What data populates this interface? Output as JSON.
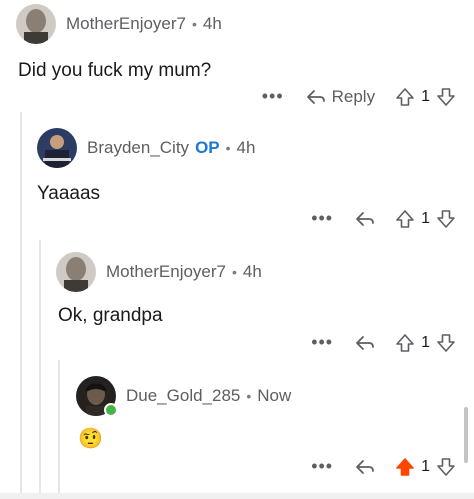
{
  "comments": [
    {
      "username": "MotherEnjoyer7",
      "op": "",
      "time": "4h",
      "body": "Did you fuck my mum?",
      "reply_label": "Reply",
      "votes": "1",
      "upvoted": false
    },
    {
      "username": "Brayden_City",
      "op": "OP",
      "time": "4h",
      "body": "Yaaaas",
      "reply_label": "",
      "votes": "1",
      "upvoted": false
    },
    {
      "username": "MotherEnjoyer7",
      "op": "",
      "time": "4h",
      "body": "Ok, grandpa",
      "reply_label": "",
      "votes": "1",
      "upvoted": false
    },
    {
      "username": "Due_Gold_285",
      "op": "",
      "time": "Now",
      "body": "🤨",
      "reply_label": "",
      "votes": "1",
      "upvoted": true
    }
  ],
  "ui": {
    "separator": "•",
    "more": "•••"
  },
  "icons": {
    "more": "more-icon",
    "reply": "reply-arrow-icon",
    "upvote": "upvote-arrow-icon",
    "downvote": "downvote-arrow-icon",
    "online": "online-status-icon"
  },
  "colors": {
    "upvote_active": "#ff4500",
    "op_badge": "#1d77d6",
    "online": "#46b34a"
  }
}
